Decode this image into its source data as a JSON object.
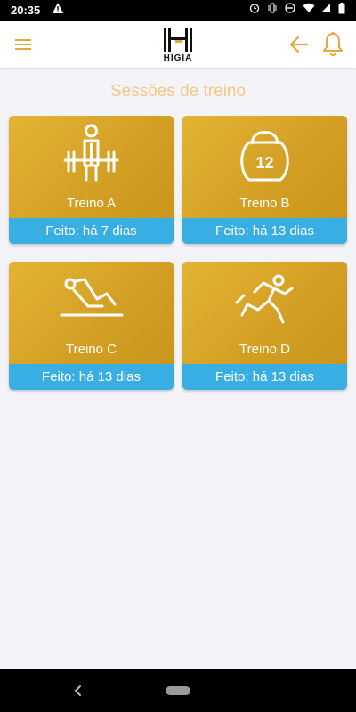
{
  "status_bar": {
    "time": "20:35",
    "icons": [
      "warning-icon",
      "alarm-icon",
      "vibrate-icon",
      "dnd-icon",
      "wifi-icon",
      "signal-icon",
      "battery-icon"
    ]
  },
  "header": {
    "logo_text": "HIGIA",
    "menu_icon": "menu-icon",
    "back_icon": "arrow-left-icon",
    "notification_icon": "bell-icon"
  },
  "section_title": "Sessões de treino",
  "cards": [
    {
      "label": "Treino A",
      "status": "Feito: há 7 dias",
      "icon": "weightlifter-icon"
    },
    {
      "label": "Treino B",
      "status": "Feito: há 13 dias",
      "icon": "kettlebell-icon",
      "icon_text": "12"
    },
    {
      "label": "Treino C",
      "status": "Feito: há 13 dias",
      "icon": "situp-icon"
    },
    {
      "label": "Treino D",
      "status": "Feito: há 13 dias",
      "icon": "runner-icon"
    }
  ],
  "colors": {
    "accent": "#e8a83a",
    "card_gold": "#d9a52a",
    "status_blue": "#38aee3",
    "title": "#f0c88a",
    "background": "#f4f4f8"
  }
}
